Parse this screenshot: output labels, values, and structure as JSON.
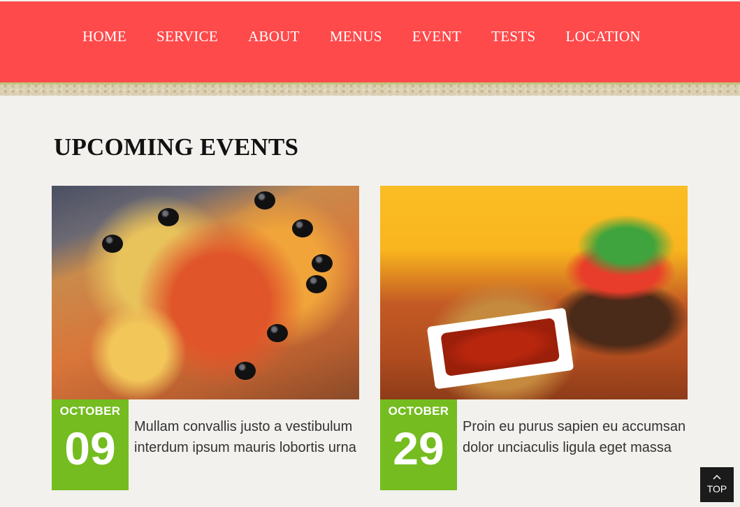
{
  "nav": {
    "items": [
      {
        "label": "HOME"
      },
      {
        "label": "SERVICE"
      },
      {
        "label": "ABOUT"
      },
      {
        "label": "MENUS"
      },
      {
        "label": "EVENT"
      },
      {
        "label": "TESTS"
      },
      {
        "label": "LOCATION"
      }
    ]
  },
  "section": {
    "title": "UPCOMING EVENTS"
  },
  "events": [
    {
      "month": "OCTOBER",
      "day": "09",
      "description": "Mullam convallis justo a vestibulum interdum ipsum mauris lobortis urna"
    },
    {
      "month": "OCTOBER",
      "day": "29",
      "description": "Proin eu purus sapien eu accumsan dolor unciaculis ligula eget massa"
    }
  ],
  "scroll_top": {
    "icon": "chevron-up-icon",
    "label": "TOP"
  },
  "colors": {
    "navbar": "#fe4a4b",
    "date_badge": "#74bc1f",
    "background": "#f2f1ee"
  }
}
